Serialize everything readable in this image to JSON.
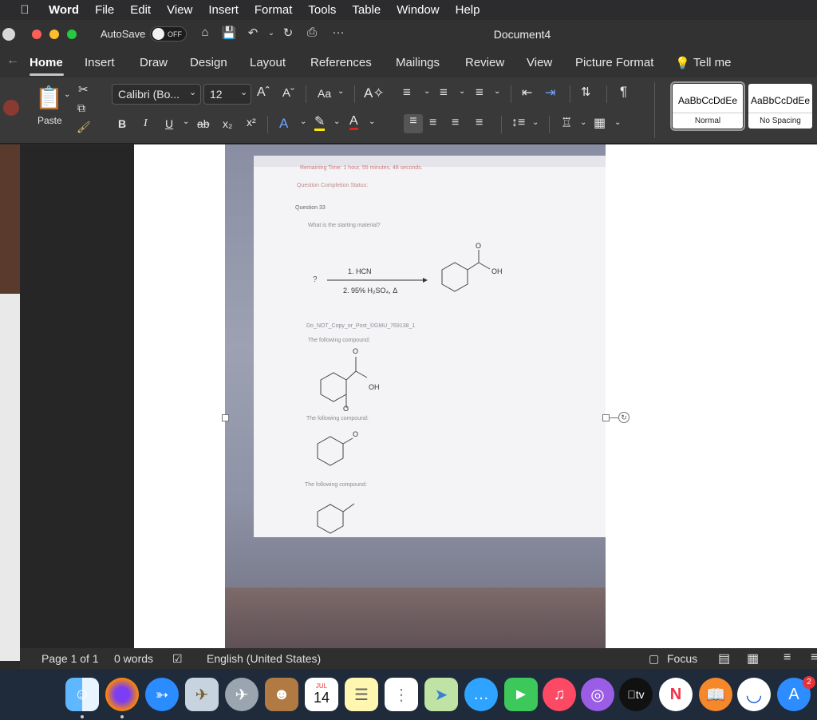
{
  "menubar": {
    "app": "Word",
    "items": [
      "File",
      "Edit",
      "View",
      "Insert",
      "Format",
      "Tools",
      "Table",
      "Window",
      "Help"
    ]
  },
  "titlebar": {
    "autosave_label": "AutoSave",
    "autosave_state": "OFF",
    "document_title": "Document4",
    "more": "···"
  },
  "tabs": [
    "Home",
    "Insert",
    "Draw",
    "Design",
    "Layout",
    "References",
    "Mailings",
    "Review",
    "View",
    "Picture Format",
    "Tell me"
  ],
  "ribbon": {
    "paste_label": "Paste",
    "font_name": "Calibri (Bo...",
    "font_size": "12",
    "bold": "B",
    "italic": "I",
    "underline": "U",
    "strike": "ab",
    "subscript": "x₂",
    "superscript": "x²",
    "change_case": "Aa",
    "styles": [
      {
        "sample": "AaBbCcDdEe",
        "name": "Normal"
      },
      {
        "sample": "AaBbCcDdEe",
        "name": "No Spacing"
      }
    ]
  },
  "photo_content": {
    "remaining_time": "Remaining Time: 1 hour, 55 minutes, 48 seconds.",
    "completion": "Question Completion Status:",
    "question_no": "Question 33",
    "question_text": "What is the starting material?",
    "reagent1": "1. HCN",
    "reagent2": "2. 95% H₂SO₄, Δ",
    "unknown": "?",
    "oh": "OH",
    "oxygen": "O",
    "watermark": "Do_NOT_Copy_or_Post_©GMU_769138_1",
    "option": "The following compound:"
  },
  "statusbar": {
    "page": "Page 1 of 1",
    "words": "0 words",
    "language": "English (United States)",
    "focus": "Focus"
  },
  "dock": {
    "calendar_month": "JUL",
    "calendar_day": "14",
    "appstore_badge": "2",
    "tv_label": "tv"
  }
}
